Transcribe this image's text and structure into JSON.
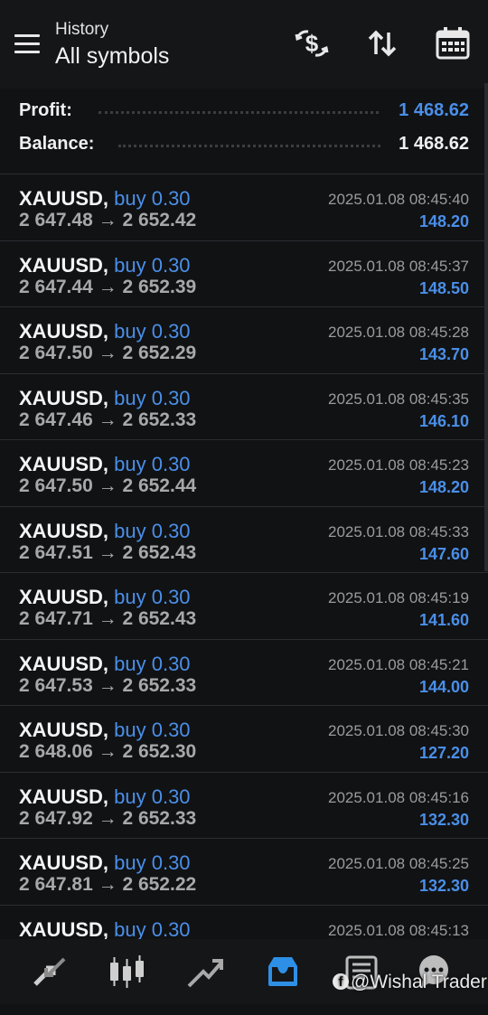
{
  "header": {
    "subtitle": "History",
    "title": "All symbols",
    "icons": [
      "menu-icon",
      "dollar-exchange-icon",
      "sort-icon",
      "calendar-icon"
    ]
  },
  "summary": {
    "profit_label": "Profit:",
    "profit_value": "1 468.62",
    "balance_label": "Balance:",
    "balance_value": "1 468.62",
    "profit_color": "#4a8fe8"
  },
  "trades": [
    {
      "symbol": "XAUUSD,",
      "side": "buy 0.30",
      "open": "2 647.48",
      "arrow": "→",
      "close": "2 652.42",
      "time": "2025.01.08 08:45:40",
      "profit": "148.20"
    },
    {
      "symbol": "XAUUSD,",
      "side": "buy 0.30",
      "open": "2 647.44",
      "arrow": "→",
      "close": "2 652.39",
      "time": "2025.01.08 08:45:37",
      "profit": "148.50"
    },
    {
      "symbol": "XAUUSD,",
      "side": "buy 0.30",
      "open": "2 647.50",
      "arrow": "→",
      "close": "2 652.29",
      "time": "2025.01.08 08:45:28",
      "profit": "143.70"
    },
    {
      "symbol": "XAUUSD,",
      "side": "buy 0.30",
      "open": "2 647.46",
      "arrow": "→",
      "close": "2 652.33",
      "time": "2025.01.08 08:45:35",
      "profit": "146.10"
    },
    {
      "symbol": "XAUUSD,",
      "side": "buy 0.30",
      "open": "2 647.50",
      "arrow": "→",
      "close": "2 652.44",
      "time": "2025.01.08 08:45:23",
      "profit": "148.20"
    },
    {
      "symbol": "XAUUSD,",
      "side": "buy 0.30",
      "open": "2 647.51",
      "arrow": "→",
      "close": "2 652.43",
      "time": "2025.01.08 08:45:33",
      "profit": "147.60"
    },
    {
      "symbol": "XAUUSD,",
      "side": "buy 0.30",
      "open": "2 647.71",
      "arrow": "→",
      "close": "2 652.43",
      "time": "2025.01.08 08:45:19",
      "profit": "141.60"
    },
    {
      "symbol": "XAUUSD,",
      "side": "buy 0.30",
      "open": "2 647.53",
      "arrow": "→",
      "close": "2 652.33",
      "time": "2025.01.08 08:45:21",
      "profit": "144.00"
    },
    {
      "symbol": "XAUUSD,",
      "side": "buy 0.30",
      "open": "2 648.06",
      "arrow": "→",
      "close": "2 652.30",
      "time": "2025.01.08 08:45:30",
      "profit": "127.20"
    },
    {
      "symbol": "XAUUSD,",
      "side": "buy 0.30",
      "open": "2 647.92",
      "arrow": "→",
      "close": "2 652.33",
      "time": "2025.01.08 08:45:16",
      "profit": "132.30"
    },
    {
      "symbol": "XAUUSD,",
      "side": "buy 0.30",
      "open": "2 647.81",
      "arrow": "→",
      "close": "2 652.22",
      "time": "2025.01.08 08:45:25",
      "profit": "132.30"
    },
    {
      "symbol": "XAUUSD,",
      "side": "buy 0.30",
      "open": "",
      "arrow": "",
      "close": "",
      "time": "2025.01.08 08:45:13",
      "profit": ""
    }
  ],
  "bottom_nav": {
    "items": [
      "quotes-icon",
      "chart-icon",
      "trade-icon",
      "history-icon",
      "news-icon",
      "messages-icon"
    ],
    "active": "history-icon",
    "active_color": "#2e8fe6"
  },
  "watermark": {
    "fb": "f",
    "text": "@Wishal Trader"
  }
}
